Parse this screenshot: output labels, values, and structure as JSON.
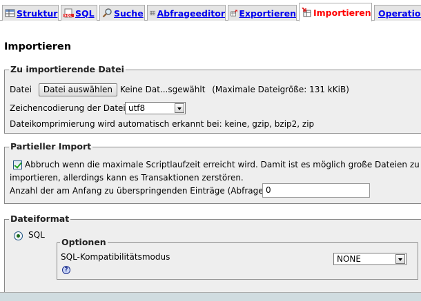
{
  "tabs": [
    {
      "label": "Struktur",
      "icon": "table-structure-icon"
    },
    {
      "label": "SQL",
      "icon": "sql-icon"
    },
    {
      "label": "Suche",
      "icon": "magnifier-icon"
    },
    {
      "label": "Abfrageeditor",
      "icon": "query-editor-icon"
    },
    {
      "label": "Exportieren",
      "icon": "export-icon"
    },
    {
      "label": "Importieren",
      "icon": "import-icon",
      "active": true
    },
    {
      "label": "Operationen",
      "icon": "wrench-icon"
    }
  ],
  "page": {
    "title": "Importieren"
  },
  "file_section": {
    "legend": "Zu importierende Datei",
    "file_label": "Datei",
    "file_button": "Datei auswählen",
    "file_status": "Keine Dat...sgewählt",
    "max_size": "(Maximale Dateigröße: 131 kKiB)",
    "charset_label": "Zeichencodierung der Datei:",
    "charset_value": "utf8",
    "compression_note": "Dateikomprimierung wird automatisch erkannt bei: keine, gzip, bzip2, zip"
  },
  "partial_section": {
    "legend": "Partieller Import",
    "allow_interrupt_line1": "Abbruch wenn die maximale Scriptlaufzeit erreicht wird. Damit ist es möglich große Dateien zu",
    "allow_interrupt_line2": "importieren, allerdings kann es Transaktionen zerstören.",
    "allow_interrupt_checked": true,
    "skip_label": "Anzahl der am Anfang zu überspringenden Einträge (Abfragen)",
    "skip_value": "0"
  },
  "format_section": {
    "legend": "Dateiformat",
    "format_option": "SQL",
    "format_selected": true,
    "options_legend": "Optionen",
    "compat_label": "SQL-Kompatibilitätsmodus",
    "compat_value": "NONE",
    "help_glyph": "?"
  },
  "colors": {
    "accent_arrow": "#1ea6e0",
    "active_tab_text": "#ff0000",
    "tab_text": "#0000ee"
  }
}
